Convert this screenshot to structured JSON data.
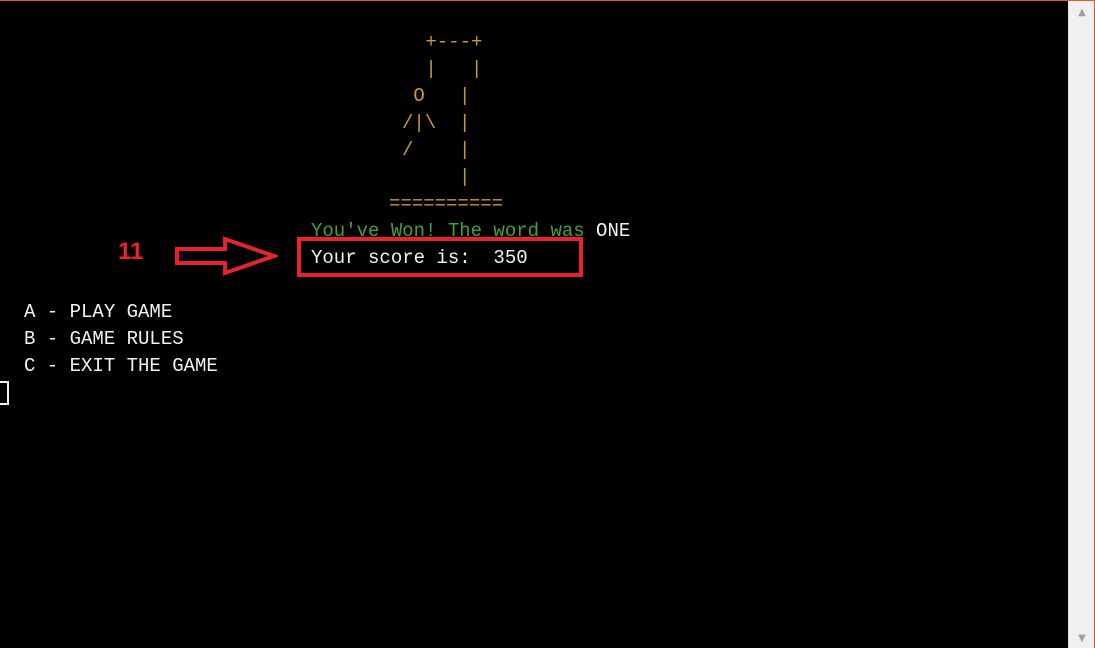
{
  "terminal": {
    "gallows_lines": [
      " +---+",
      " |   |",
      " O   |",
      "/|\\  |",
      "/    |",
      "     |",
      "=========="
    ],
    "win_message": "You've Won! The word was ",
    "win_word": "ONE",
    "score_text": "Your score is:  350",
    "menu_options": [
      "A - PLAY GAME",
      "B - GAME RULES",
      "C - EXIT THE GAME"
    ]
  },
  "annotation": {
    "step_number": "11"
  },
  "colors": {
    "background": "#000000",
    "gallows": "#c89b2d",
    "win_message": "#3ea23e",
    "text": "#f2f2f2",
    "annotation": "#e8232c"
  },
  "icons": {
    "scroll_up": "triangle-up-icon",
    "scroll_down": "triangle-down-icon",
    "arrow": "right-arrow-icon"
  }
}
